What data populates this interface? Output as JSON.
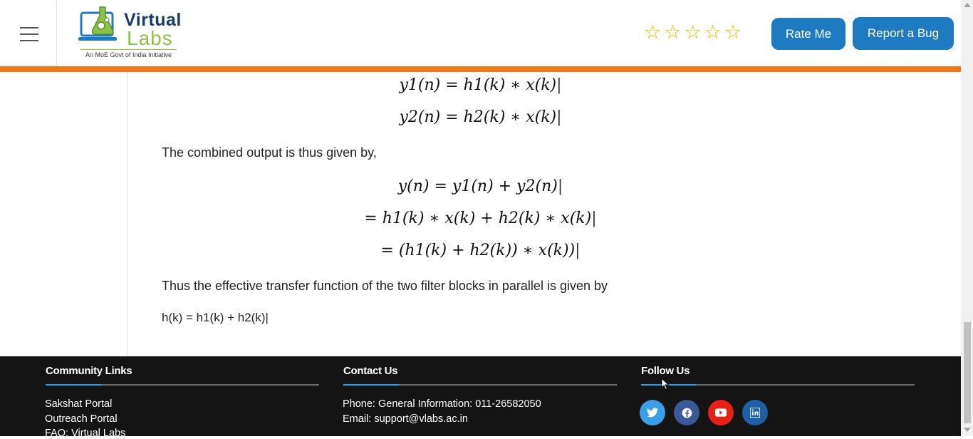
{
  "header": {
    "logo_word1": "Virtual",
    "logo_word2": "Labs",
    "logo_tagline": "An MoE Govt of India Initiative",
    "stars": [
      "☆",
      "☆",
      "☆",
      "☆",
      "☆"
    ],
    "rate_label": "Rate Me",
    "bug_label": "Report a Bug",
    "accent_color": "#1e7bc2",
    "bar_color": "#f07819"
  },
  "content": {
    "eq1": "y1(n) = h1(k) ∗ x(k)",
    "eq2": "y2(n) = h2(k) ∗ x(k)",
    "para1": "The combined output is thus given by,",
    "eq3": "y(n) = y1(n) + y2(n)",
    "eq4": "= h1(k) ∗ x(k) + h2(k) ∗ x(k)",
    "eq5": "= (h1(k) + h2(k)) ∗ x(k))",
    "para2": "Thus the effective transfer function of the two filter blocks in parallel is given by",
    "eq6": "h(k) = h1(k) + h2(k)",
    "cursor": "|"
  },
  "footer": {
    "community_title": "Community Links",
    "community_links": [
      "Sakshat Portal",
      "Outreach Portal",
      "FAQ: Virtual Labs"
    ],
    "contact_title": "Contact Us",
    "contact_phone": "Phone: General Information: 011-26582050",
    "contact_email": "Email: support@vlabs.ac.in",
    "follow_title": "Follow Us",
    "social_icons": [
      "twitter-icon",
      "facebook-icon",
      "youtube-icon",
      "linkedin-icon"
    ],
    "social_colors": [
      "#3b9ee8",
      "#3b5998",
      "#e62117",
      "#1f5fa6"
    ]
  }
}
